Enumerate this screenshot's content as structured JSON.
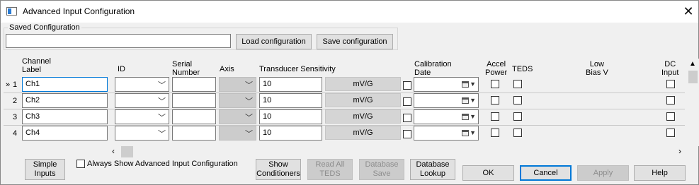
{
  "window": {
    "title": "Advanced Input Configuration"
  },
  "saved_config": {
    "legend": "Saved Configuration",
    "value": "",
    "load_label": "Load configuration",
    "save_label": "Save configuration"
  },
  "columns": {
    "channel_label": "Channel\nLabel",
    "id": "ID",
    "serial_number": "Serial\nNumber",
    "axis": "Axis",
    "transducer_sensitivity": "Transducer Sensitivity",
    "calibration_date": "Calibration\nDate",
    "accel_power": "Accel\nPower",
    "teds": "TEDS",
    "low_bias_v": "Low\nBias V",
    "dc_input": "DC\nInput"
  },
  "rows": [
    {
      "marker": "»",
      "num": "1",
      "label": "Ch1",
      "id": "",
      "serial": "",
      "axis": "",
      "sensitivity": "10",
      "unit": "mV/G"
    },
    {
      "marker": "",
      "num": "2",
      "label": "Ch2",
      "id": "",
      "serial": "",
      "axis": "",
      "sensitivity": "10",
      "unit": "mV/G"
    },
    {
      "marker": "",
      "num": "3",
      "label": "Ch3",
      "id": "",
      "serial": "",
      "axis": "",
      "sensitivity": "10",
      "unit": "mV/G"
    },
    {
      "marker": "",
      "num": "4",
      "label": "Ch4",
      "id": "",
      "serial": "",
      "axis": "",
      "sensitivity": "10",
      "unit": "mV/G"
    }
  ],
  "footer": {
    "simple_inputs": "Simple\nInputs",
    "always_show": "Always Show Advanced Input Configuration",
    "show_conditioners": "Show\nConditioners",
    "read_all_teds": "Read All\nTEDS",
    "database_save": "Database\nSave",
    "database_lookup": "Database\nLookup",
    "ok": "OK",
    "cancel": "Cancel",
    "apply": "Apply",
    "help": "Help"
  },
  "icons": {
    "close": "close-icon",
    "app": "window-icon",
    "chevron": "chevron-down-icon",
    "calendar": "calendar-icon"
  },
  "colors": {
    "accent": "#0078d7",
    "window_bg": "#f0f0f0",
    "disabled_bg": "#cccccc"
  }
}
